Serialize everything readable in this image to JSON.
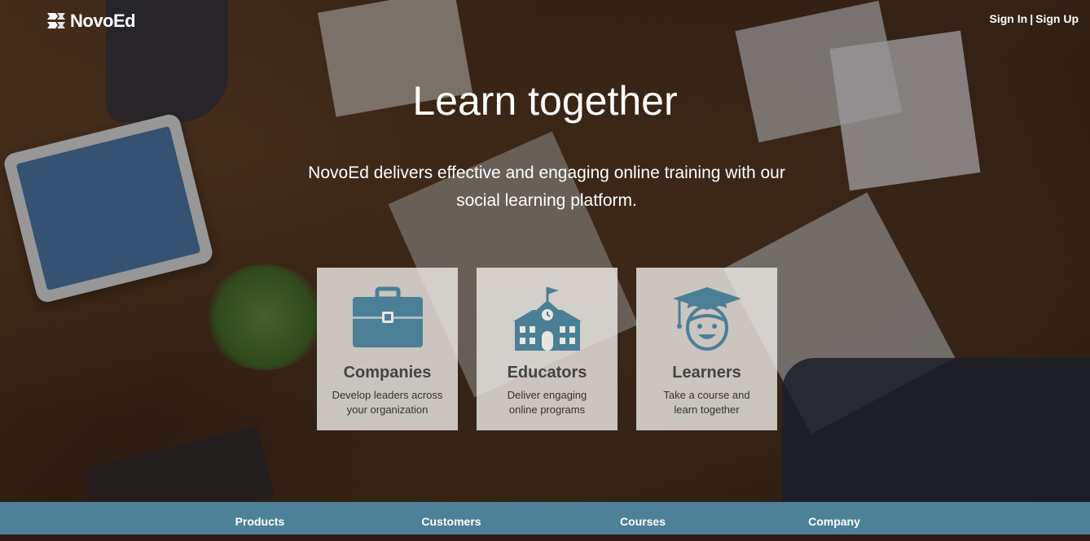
{
  "brand": {
    "name": "NovoEd"
  },
  "auth": {
    "sign_in": "Sign In",
    "separator": "|",
    "sign_up": "Sign Up"
  },
  "hero": {
    "title": "Learn together",
    "subtitle": "NovoEd delivers effective and engaging online training with our social learning platform."
  },
  "cards": [
    {
      "icon": "briefcase-icon",
      "title": "Companies",
      "line1": "Develop leaders across",
      "line2": "your organization"
    },
    {
      "icon": "school-building-icon",
      "title": "Educators",
      "line1": "Deliver engaging",
      "line2": "online programs"
    },
    {
      "icon": "graduate-face-icon",
      "title": "Learners",
      "line1": "Take a course and",
      "line2": "learn together"
    }
  ],
  "footer": {
    "items": [
      "Products",
      "Customers",
      "Courses",
      "Company"
    ]
  },
  "colors": {
    "accent": "#4d8198",
    "icon": "#4a7f96",
    "card_bg": "#ebe8e4"
  }
}
